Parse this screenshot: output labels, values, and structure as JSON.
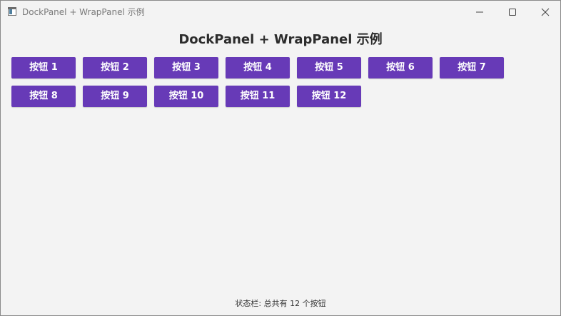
{
  "window": {
    "title": "DockPanel + WrapPanel 示例",
    "icon": "app-window-icon"
  },
  "caption_buttons": {
    "minimize_icon": "minimize-icon",
    "maximize_icon": "maximize-icon",
    "close_icon": "close-icon"
  },
  "header": {
    "title": "DockPanel + WrapPanel 示例"
  },
  "buttons": [
    {
      "label": "按钮 1"
    },
    {
      "label": "按钮 2"
    },
    {
      "label": "按钮 3"
    },
    {
      "label": "按钮 4"
    },
    {
      "label": "按钮 5"
    },
    {
      "label": "按钮 6"
    },
    {
      "label": "按钮 7"
    },
    {
      "label": "按钮 8"
    },
    {
      "label": "按钮 9"
    },
    {
      "label": "按钮 10"
    },
    {
      "label": "按钮 11"
    },
    {
      "label": "按钮 12"
    }
  ],
  "colors": {
    "button_background": "#673ab7",
    "button_text": "#ffffff",
    "window_background": "#f3f3f3"
  },
  "status_bar": {
    "text": "状态栏: 总共有 12 个按钮"
  }
}
